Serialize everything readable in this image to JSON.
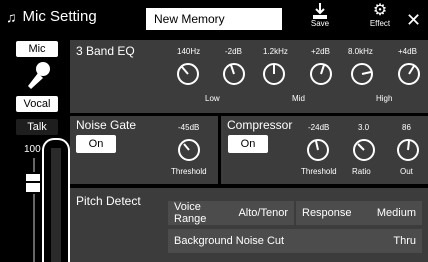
{
  "header": {
    "title": "Mic Setting",
    "memory_name": "New Memory",
    "save_label": "Save",
    "effect_label": "Effect"
  },
  "left": {
    "tab_mic": "Mic",
    "tab_vocal": "Vocal",
    "tab_talk": "Talk",
    "level_value": "100"
  },
  "eq": {
    "title": "3 Band EQ",
    "bands": [
      {
        "name": "Low",
        "freq": "140Hz",
        "gain": "-2dB"
      },
      {
        "name": "Mid",
        "freq": "1.2kHz",
        "gain": "+2dB"
      },
      {
        "name": "High",
        "freq": "8.0kHz",
        "gain": "+4dB"
      }
    ]
  },
  "noise_gate": {
    "title": "Noise Gate",
    "on_label": "On",
    "threshold_value": "-45dB",
    "threshold_label": "Threshold"
  },
  "compressor": {
    "title": "Compressor",
    "on_label": "On",
    "params": [
      {
        "label": "Threshold",
        "value": "-24dB"
      },
      {
        "label": "Ratio",
        "value": "3.0"
      },
      {
        "label": "Out",
        "value": "86"
      }
    ]
  },
  "pitch_detect": {
    "title": "Pitch Detect",
    "voice_range_label": "Voice Range",
    "voice_range_value": "Alto/Tenor",
    "response_label": "Response",
    "response_value": "Medium",
    "bg_noise_label": "Background Noise Cut",
    "bg_noise_value": "Thru"
  }
}
